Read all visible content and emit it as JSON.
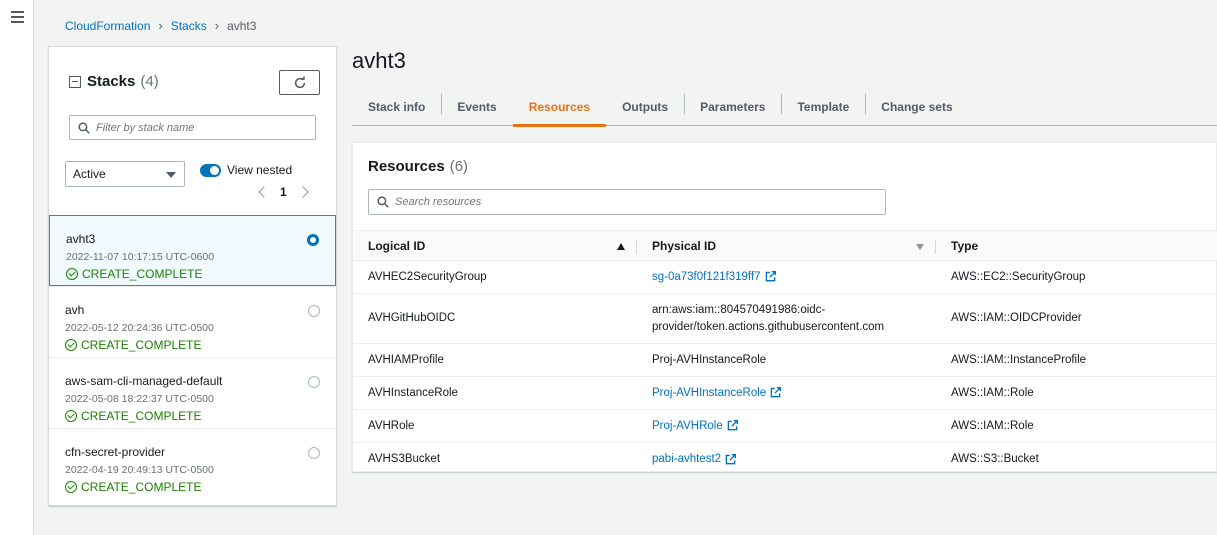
{
  "breadcrumb": {
    "root": "CloudFormation",
    "section": "Stacks",
    "current": "avht3"
  },
  "stacks_panel": {
    "title": "Stacks",
    "count": "(4)",
    "filter_placeholder": "Filter by stack name",
    "status_filter": "Active",
    "view_nested_label": "View nested",
    "page": "1"
  },
  "stacks": [
    {
      "name": "avht3",
      "date": "2022-11-07 10:17:15 UTC-0600",
      "status": "CREATE_COMPLETE",
      "selected": true
    },
    {
      "name": "avh",
      "date": "2022-05-12 20:24:36 UTC-0500",
      "status": "CREATE_COMPLETE",
      "selected": false
    },
    {
      "name": "aws-sam-cli-managed-default",
      "date": "2022-05-08 18:22:37 UTC-0500",
      "status": "CREATE_COMPLETE",
      "selected": false
    },
    {
      "name": "cfn-secret-provider",
      "date": "2022-04-19 20:49:13 UTC-0500",
      "status": "CREATE_COMPLETE",
      "selected": false
    }
  ],
  "page_title": "avht3",
  "tabs": [
    "Stack info",
    "Events",
    "Resources",
    "Outputs",
    "Parameters",
    "Template",
    "Change sets"
  ],
  "active_tab": "Resources",
  "resources": {
    "title": "Resources",
    "count": "(6)",
    "search_placeholder": "Search resources",
    "columns": [
      "Logical ID",
      "Physical ID",
      "Type"
    ],
    "rows": [
      {
        "logical_id": "AVHEC2SecurityGroup",
        "physical_id": "sg-0a73f0f121f319ff7",
        "physical_link": true,
        "type": "AWS::EC2::SecurityGroup"
      },
      {
        "logical_id": "AVHGitHubOIDC",
        "physical_id": "arn:aws:iam::804570491986:oidc-provider/token.actions.githubusercontent.com",
        "physical_link": false,
        "type": "AWS::IAM::OIDCProvider"
      },
      {
        "logical_id": "AVHIAMProfile",
        "physical_id": "Proj-AVHInstanceRole",
        "physical_link": false,
        "type": "AWS::IAM::InstanceProfile"
      },
      {
        "logical_id": "AVHInstanceRole",
        "physical_id": "Proj-AVHInstanceRole",
        "physical_link": true,
        "type": "AWS::IAM::Role"
      },
      {
        "logical_id": "AVHRole",
        "physical_id": "Proj-AVHRole",
        "physical_link": true,
        "type": "AWS::IAM::Role"
      },
      {
        "logical_id": "AVHS3Bucket",
        "physical_id": "pabi-avhtest2",
        "physical_link": true,
        "type": "AWS::S3::Bucket"
      }
    ]
  },
  "colors": {
    "link": "#0073bb",
    "accent": "#ec7211",
    "success": "#1d8102"
  }
}
